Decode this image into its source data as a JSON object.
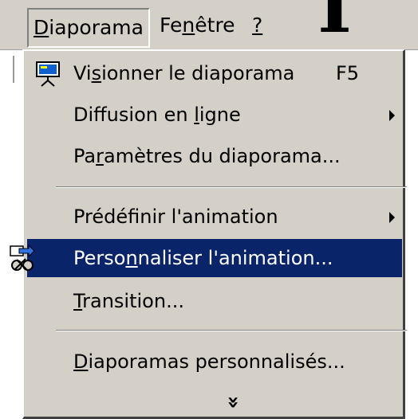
{
  "menubar": {
    "diaporama": {
      "pre": "",
      "key": "D",
      "post": "iaporama"
    },
    "fenetre": {
      "pre": "Fe",
      "key": "n",
      "post": "être"
    },
    "help": {
      "key": "?"
    }
  },
  "big_glyph": "I",
  "dropdown": {
    "items": [
      {
        "pre": "Vi",
        "key": "s",
        "post": "ionner le diaporama",
        "shortcut": "F5",
        "icon": "slideshow-icon"
      },
      {
        "pre": "Diffusion en ",
        "key": "l",
        "post": "igne",
        "submenu": true
      },
      {
        "pre": "Pa",
        "key": "r",
        "post": "amètres du diaporama..."
      },
      {
        "pre": "Prédéf",
        "key": "i",
        "post": "nir l'animation",
        "submenu": true
      },
      {
        "pre": "Perso",
        "key": "n",
        "post": "naliser l'animation...",
        "icon": "custom-animation-icon",
        "highlighted": true
      },
      {
        "pre": "",
        "key": "T",
        "post": "ransition..."
      },
      {
        "pre": "",
        "key": "D",
        "post": "iaporamas personnalisés..."
      }
    ],
    "expand_glyph": "»",
    "highlight_color": "#0a246a",
    "background_color": "#d4d0c8"
  }
}
